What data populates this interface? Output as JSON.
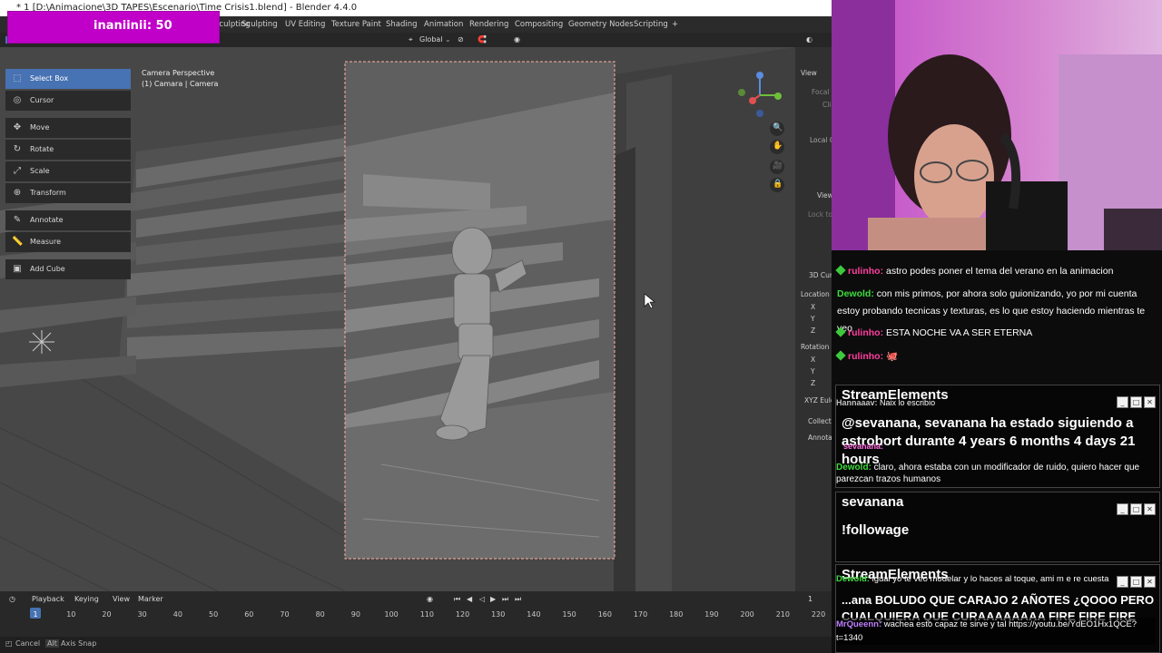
{
  "window": {
    "title": "* 1 [D:\\Animacione\\3D TAPES\\Escenario\\Time Crisis1.blend] - Blender 4.4.0"
  },
  "overlay": {
    "label": "inaniinii: 50"
  },
  "workspaces": [
    "Sculpting",
    "UV Editing",
    "Texture Paint",
    "Shading",
    "Animation",
    "Rendering",
    "Compositing",
    "Geometry Nodes",
    "Scripting",
    "+"
  ],
  "header": {
    "orientation": "Global"
  },
  "tools": [
    {
      "label": "Select Box",
      "icon": "select-box-icon",
      "selected": true
    },
    {
      "label": "Cursor",
      "icon": "cursor-icon",
      "selected": false
    },
    {
      "label": "Move",
      "icon": "move-icon",
      "selected": false
    },
    {
      "label": "Rotate",
      "icon": "rotate-icon",
      "selected": false
    },
    {
      "label": "Scale",
      "icon": "scale-icon",
      "selected": false
    },
    {
      "label": "Transform",
      "icon": "transform-icon",
      "selected": false
    },
    {
      "label": "Annotate",
      "icon": "annotate-icon",
      "selected": false
    },
    {
      "label": "Measure",
      "icon": "measure-icon",
      "selected": false
    },
    {
      "label": "Add Cube",
      "icon": "add-cube-icon",
      "selected": false
    }
  ],
  "viewport": {
    "camera_line1": "Camera Perspective",
    "camera_line2": "(1) Camara | Camera"
  },
  "props": {
    "view": "View",
    "focal": "Focal L",
    "clip": "Cli",
    "local": "Local C",
    "view2": "View",
    "lock": "Lock to",
    "cursor3d": "3D Curs",
    "location": "Location",
    "x": "X",
    "y": "Y",
    "z": "Z",
    "rotation": "Rotation",
    "rx": "X",
    "ry": "Y",
    "rz": "Z",
    "euler": "XYZ Eule",
    "collections": "Collecti",
    "annotations": "Annotat"
  },
  "timeline": {
    "playback": "Playback",
    "keying": "Keying",
    "view": "View",
    "marker": "Marker",
    "current_frame": "1",
    "frame_ticks": [
      "1",
      "10",
      "20",
      "30",
      "40",
      "50",
      "60",
      "70",
      "80",
      "90",
      "100",
      "110",
      "120",
      "130",
      "140",
      "150",
      "160",
      "170",
      "180",
      "190",
      "200",
      "210",
      "220"
    ]
  },
  "statusbar": {
    "cancel": "Cancel",
    "alt": "Alt",
    "axis_snap": "Axis Snap"
  },
  "chat": {
    "messages": [
      {
        "user": "rulinho:",
        "text": "astro podes poner el tema del verano en la animacion",
        "color": "#ff3f9f",
        "badge": true
      },
      {
        "user": "Dewold:",
        "text": "con mis primos, por ahora solo guionizando, yo por mi cuenta estoy probando tecnicas y texturas, es lo que estoy haciendo mientras te veo",
        "color": "#3fdc3f",
        "badge": false
      },
      {
        "user": "rulinho:",
        "text": "ESTA NOCHE VA A SER ETERNA",
        "color": "#ff3f9f",
        "badge": true
      },
      {
        "user": "rulinho:",
        "text": "🐙",
        "color": "#ff3f9f",
        "badge": true
      },
      {
        "user": "Hannaaav:",
        "text": "Naix lo escribio",
        "color": "#c0c0c0",
        "badge": false
      },
      {
        "user": "sevanana:",
        "text": "",
        "color": "#ff6fe0",
        "badge": false
      },
      {
        "user": "Dewold:",
        "text": "claro, ahora estaba con un modificador de ruido, quiero hacer que parezcan trazos humanos",
        "color": "#3fdc3f",
        "badge": false
      },
      {
        "user": "Dewold:",
        "text": "igual yo te veo modelar y lo haces al toque, ami m e re cuesta",
        "color": "#3fdc3f",
        "badge": false
      },
      {
        "user": "MrQueenn:",
        "text": "wachea esto capaz te sirve y tal https://youtu.be/YdEO1Hx1QCE?t=1340",
        "color": "#bf7fff",
        "badge": false
      }
    ],
    "popups": [
      {
        "title": "StreamElements",
        "text": "@sevanana, sevanana ha estado siguiendo a astrobort durante 4 years 6 months 4 days 21 hours"
      },
      {
        "title": "sevanana",
        "text": "!followage"
      },
      {
        "title": "StreamElements",
        "text": "...ana BOLUDO QUE CARAJO 2 AÑOTES ¿QOOO PERO CUALQUIERA QUE CURAAAAAAAA FIRE FIRE FIRE"
      }
    ]
  }
}
